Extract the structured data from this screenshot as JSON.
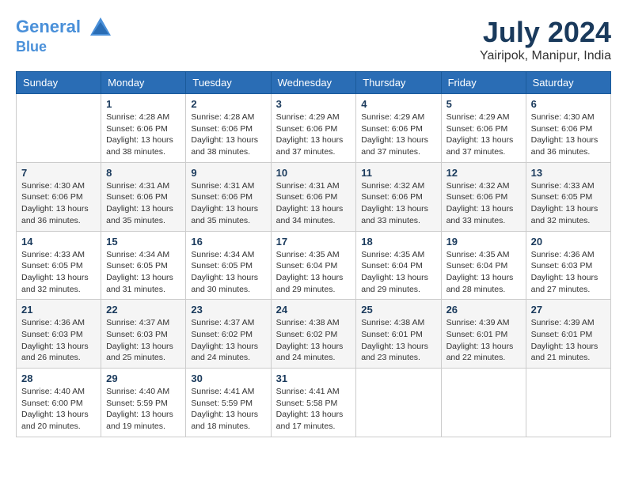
{
  "header": {
    "logo_line1": "General",
    "logo_line2": "Blue",
    "month_year": "July 2024",
    "location": "Yairipok, Manipur, India"
  },
  "weekdays": [
    "Sunday",
    "Monday",
    "Tuesday",
    "Wednesday",
    "Thursday",
    "Friday",
    "Saturday"
  ],
  "weeks": [
    [
      {
        "day": "",
        "info": ""
      },
      {
        "day": "1",
        "info": "Sunrise: 4:28 AM\nSunset: 6:06 PM\nDaylight: 13 hours\nand 38 minutes."
      },
      {
        "day": "2",
        "info": "Sunrise: 4:28 AM\nSunset: 6:06 PM\nDaylight: 13 hours\nand 38 minutes."
      },
      {
        "day": "3",
        "info": "Sunrise: 4:29 AM\nSunset: 6:06 PM\nDaylight: 13 hours\nand 37 minutes."
      },
      {
        "day": "4",
        "info": "Sunrise: 4:29 AM\nSunset: 6:06 PM\nDaylight: 13 hours\nand 37 minutes."
      },
      {
        "day": "5",
        "info": "Sunrise: 4:29 AM\nSunset: 6:06 PM\nDaylight: 13 hours\nand 37 minutes."
      },
      {
        "day": "6",
        "info": "Sunrise: 4:30 AM\nSunset: 6:06 PM\nDaylight: 13 hours\nand 36 minutes."
      }
    ],
    [
      {
        "day": "7",
        "info": "Sunrise: 4:30 AM\nSunset: 6:06 PM\nDaylight: 13 hours\nand 36 minutes."
      },
      {
        "day": "8",
        "info": "Sunrise: 4:31 AM\nSunset: 6:06 PM\nDaylight: 13 hours\nand 35 minutes."
      },
      {
        "day": "9",
        "info": "Sunrise: 4:31 AM\nSunset: 6:06 PM\nDaylight: 13 hours\nand 35 minutes."
      },
      {
        "day": "10",
        "info": "Sunrise: 4:31 AM\nSunset: 6:06 PM\nDaylight: 13 hours\nand 34 minutes."
      },
      {
        "day": "11",
        "info": "Sunrise: 4:32 AM\nSunset: 6:06 PM\nDaylight: 13 hours\nand 33 minutes."
      },
      {
        "day": "12",
        "info": "Sunrise: 4:32 AM\nSunset: 6:06 PM\nDaylight: 13 hours\nand 33 minutes."
      },
      {
        "day": "13",
        "info": "Sunrise: 4:33 AM\nSunset: 6:05 PM\nDaylight: 13 hours\nand 32 minutes."
      }
    ],
    [
      {
        "day": "14",
        "info": "Sunrise: 4:33 AM\nSunset: 6:05 PM\nDaylight: 13 hours\nand 32 minutes."
      },
      {
        "day": "15",
        "info": "Sunrise: 4:34 AM\nSunset: 6:05 PM\nDaylight: 13 hours\nand 31 minutes."
      },
      {
        "day": "16",
        "info": "Sunrise: 4:34 AM\nSunset: 6:05 PM\nDaylight: 13 hours\nand 30 minutes."
      },
      {
        "day": "17",
        "info": "Sunrise: 4:35 AM\nSunset: 6:04 PM\nDaylight: 13 hours\nand 29 minutes."
      },
      {
        "day": "18",
        "info": "Sunrise: 4:35 AM\nSunset: 6:04 PM\nDaylight: 13 hours\nand 29 minutes."
      },
      {
        "day": "19",
        "info": "Sunrise: 4:35 AM\nSunset: 6:04 PM\nDaylight: 13 hours\nand 28 minutes."
      },
      {
        "day": "20",
        "info": "Sunrise: 4:36 AM\nSunset: 6:03 PM\nDaylight: 13 hours\nand 27 minutes."
      }
    ],
    [
      {
        "day": "21",
        "info": "Sunrise: 4:36 AM\nSunset: 6:03 PM\nDaylight: 13 hours\nand 26 minutes."
      },
      {
        "day": "22",
        "info": "Sunrise: 4:37 AM\nSunset: 6:03 PM\nDaylight: 13 hours\nand 25 minutes."
      },
      {
        "day": "23",
        "info": "Sunrise: 4:37 AM\nSunset: 6:02 PM\nDaylight: 13 hours\nand 24 minutes."
      },
      {
        "day": "24",
        "info": "Sunrise: 4:38 AM\nSunset: 6:02 PM\nDaylight: 13 hours\nand 24 minutes."
      },
      {
        "day": "25",
        "info": "Sunrise: 4:38 AM\nSunset: 6:01 PM\nDaylight: 13 hours\nand 23 minutes."
      },
      {
        "day": "26",
        "info": "Sunrise: 4:39 AM\nSunset: 6:01 PM\nDaylight: 13 hours\nand 22 minutes."
      },
      {
        "day": "27",
        "info": "Sunrise: 4:39 AM\nSunset: 6:01 PM\nDaylight: 13 hours\nand 21 minutes."
      }
    ],
    [
      {
        "day": "28",
        "info": "Sunrise: 4:40 AM\nSunset: 6:00 PM\nDaylight: 13 hours\nand 20 minutes."
      },
      {
        "day": "29",
        "info": "Sunrise: 4:40 AM\nSunset: 5:59 PM\nDaylight: 13 hours\nand 19 minutes."
      },
      {
        "day": "30",
        "info": "Sunrise: 4:41 AM\nSunset: 5:59 PM\nDaylight: 13 hours\nand 18 minutes."
      },
      {
        "day": "31",
        "info": "Sunrise: 4:41 AM\nSunset: 5:58 PM\nDaylight: 13 hours\nand 17 minutes."
      },
      {
        "day": "",
        "info": ""
      },
      {
        "day": "",
        "info": ""
      },
      {
        "day": "",
        "info": ""
      }
    ]
  ]
}
